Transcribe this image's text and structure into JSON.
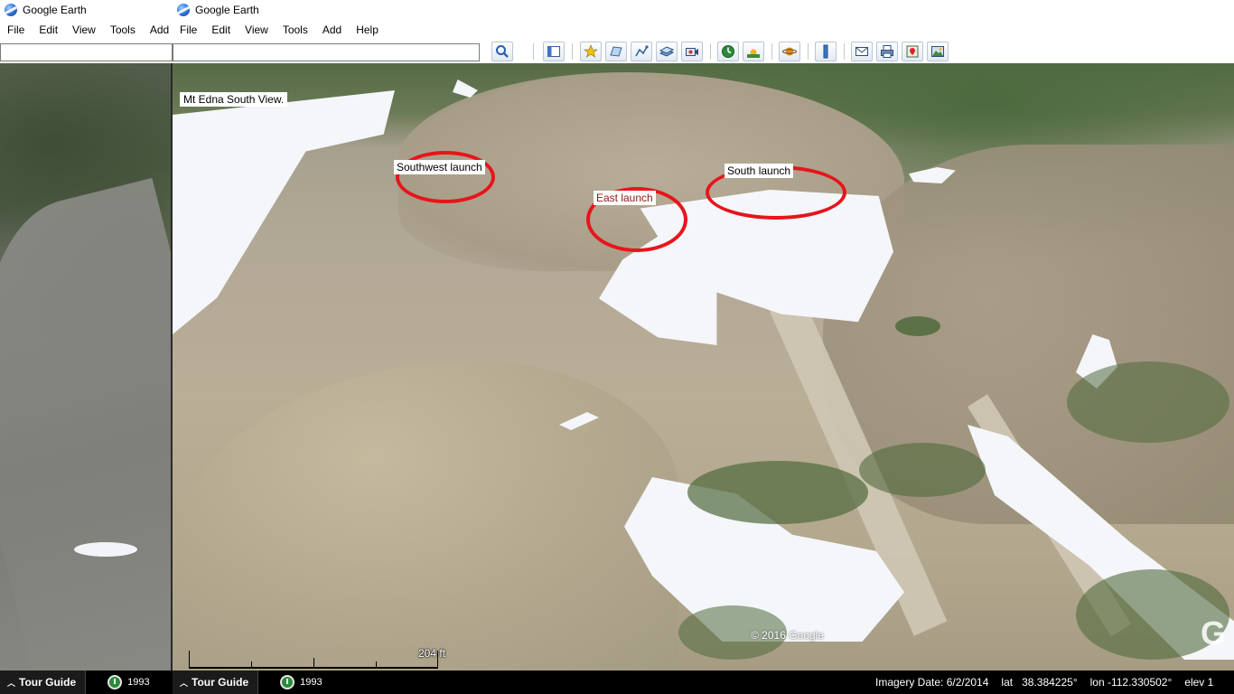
{
  "app": {
    "title": "Google Earth"
  },
  "menu": [
    "File",
    "Edit",
    "View",
    "Tools",
    "Add",
    "Help"
  ],
  "menu_left": [
    "File",
    "Edit",
    "View",
    "Tools",
    "Add"
  ],
  "search": {
    "value": "",
    "placeholder": ""
  },
  "toolbar_icons": [
    "search-icon",
    "sidebar-icon",
    "placemark-icon",
    "polygon-icon",
    "path-icon",
    "overlay-icon",
    "tour-icon",
    "historical-imagery-icon",
    "sunlight-icon",
    "planets-icon",
    "ruler-icon",
    "email-icon",
    "print-icon",
    "maps-icon",
    "save-image-icon"
  ],
  "view": {
    "title": "Mt Edna South View.",
    "annotations": {
      "southwest": "Southwest launch",
      "east": "East launch",
      "south": "South launch"
    },
    "copyright": "© 2016 Google",
    "scale_label": "204 ft",
    "watermark": "G"
  },
  "status": {
    "tour_guide": "Tour Guide",
    "year": "1993",
    "imagery_date": "Imagery Date: 6/2/2014",
    "lat": "lat   38.384225°",
    "lon": "lon -112.330502°",
    "elev": "elev 1"
  }
}
